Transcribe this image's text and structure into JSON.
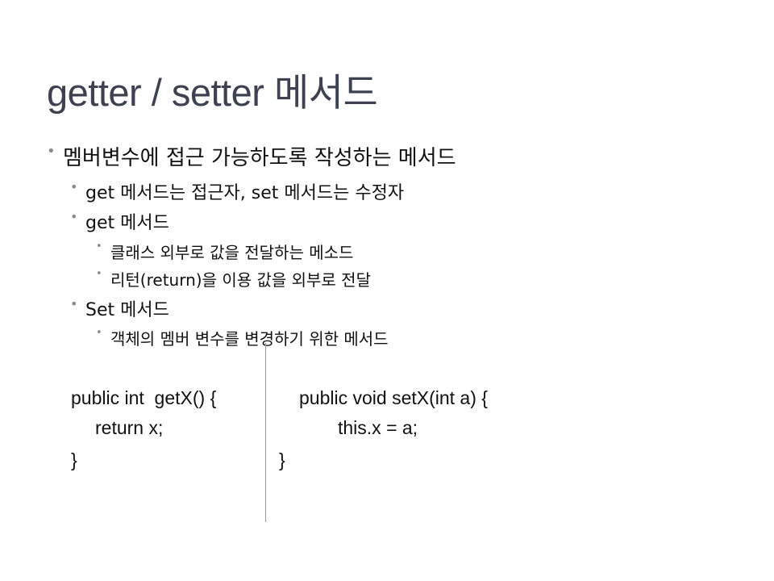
{
  "slide": {
    "title": "getter / setter 메서드",
    "bullets": [
      {
        "level": 1,
        "text": "멤버변수에 접근 가능하도록 작성하는 메서드"
      },
      {
        "level": 2,
        "text": "get 메서드는 접근자, set 메서드는 수정자"
      },
      {
        "level": 2,
        "text": "get 메서드"
      },
      {
        "level": 3,
        "text": "클래스 외부로 값을 전달하는 메소드"
      },
      {
        "level": 3,
        "text": "리턴(return)을 이용 값을 외부로 전달"
      },
      {
        "level": 2,
        "text": "Set 메서드"
      },
      {
        "level": 3,
        "text": "객체의 멤버 변수를 변경하기 위한 메서드"
      }
    ],
    "bullet_glyph": "•",
    "code_left": [
      "public int  getX() {",
      "return x;",
      "}"
    ],
    "code_right": [
      "public void setX(int a) {",
      "this.x = a;",
      "}"
    ]
  }
}
